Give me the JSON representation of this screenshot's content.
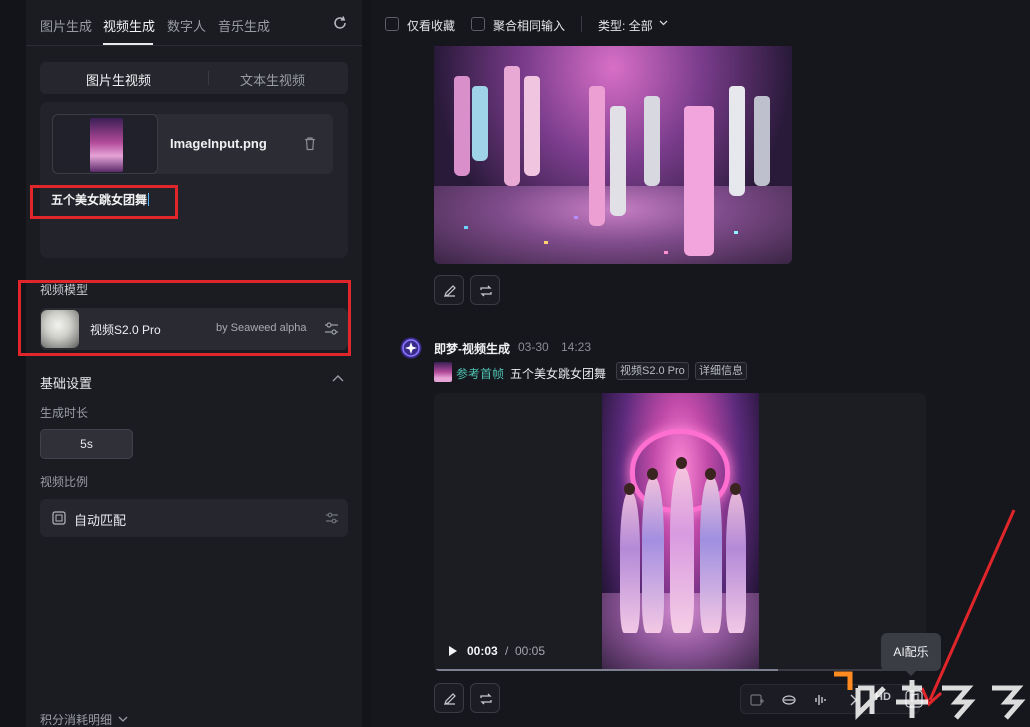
{
  "left_panel": {
    "top_tabs": [
      {
        "label": "图片生成"
      },
      {
        "label": "视频生成"
      },
      {
        "label": "数字人"
      },
      {
        "label": "音乐生成"
      }
    ],
    "sub_tabs": [
      {
        "label": "图片生视频"
      },
      {
        "label": "文本生视频"
      }
    ],
    "image_input": {
      "file_name": "ImageInput.png"
    },
    "prompt": "五个美女跳女团舞",
    "model_section": {
      "label": "视频模型",
      "model_name": "视频S2.0 Pro",
      "model_by": "by Seaweed alpha"
    },
    "basic_settings": {
      "label": "基础设置",
      "duration_label": "生成时长",
      "duration_value": "5s",
      "ratio_label": "视频比例",
      "ratio_value": "自动匹配"
    },
    "points_link": "积分消耗明细"
  },
  "filter_bar": {
    "favorites_only": "仅看收藏",
    "merge_same_input": "聚合相同输入",
    "type_filter": "类型: 全部"
  },
  "generation": {
    "title": "即梦-视频生成",
    "date": "03-30",
    "time": "14:23",
    "ref_label": "参考首帧",
    "prompt": "五个美女跳女团舞",
    "tags": [
      "视频S2.0 Pro",
      "详细信息"
    ],
    "video": {
      "current_time": "00:03",
      "separator": "/",
      "total_time": "00:05",
      "progress": 0.7
    },
    "hd_label": "HD"
  },
  "tooltip": {
    "text": "AI配乐"
  },
  "colors": {
    "highlight_red": "#e0262b",
    "accent_teal": "#4fc2b0",
    "background": "#13141a"
  }
}
